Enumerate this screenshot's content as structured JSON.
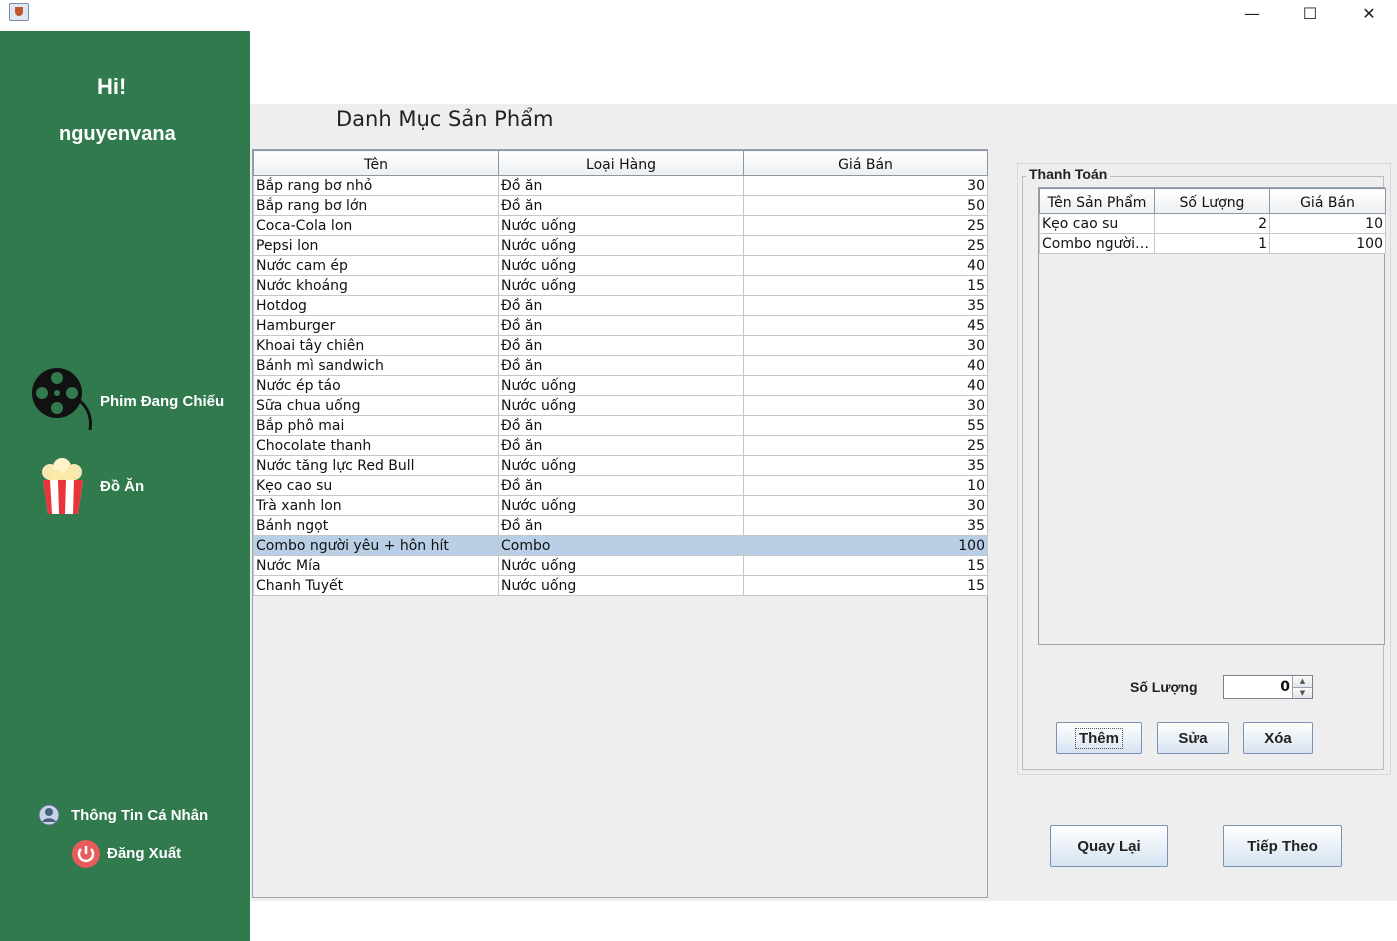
{
  "window": {
    "minimize_glyph": "—",
    "maximize_glyph": "☐",
    "close_glyph": "✕"
  },
  "sidebar": {
    "greeting": "Hi!",
    "username": "nguyenvana",
    "nav": [
      {
        "label": "Phim Đang Chiếu",
        "icon": "film-reel-icon"
      },
      {
        "label": "Đồ Ăn",
        "icon": "popcorn-icon"
      }
    ],
    "profile_label": "Thông Tin Cá Nhân",
    "logout_label": "Đăng Xuất"
  },
  "main": {
    "heading": "Danh Mục Sản Phẩm",
    "columns": [
      "Tên",
      "Loại Hàng",
      "Giá Bán"
    ],
    "rows": [
      [
        "Bắp rang bơ nhỏ",
        "Đồ ăn",
        "30"
      ],
      [
        "Bắp rang bơ lớn",
        "Đồ ăn",
        "50"
      ],
      [
        "Coca-Cola lon",
        "Nước uống",
        "25"
      ],
      [
        "Pepsi lon",
        "Nước uống",
        "25"
      ],
      [
        "Nước cam ép",
        "Nước uống",
        "40"
      ],
      [
        "Nước khoáng",
        "Nước uống",
        "15"
      ],
      [
        "Hotdog",
        "Đồ ăn",
        "35"
      ],
      [
        "Hamburger",
        "Đồ ăn",
        "45"
      ],
      [
        "Khoai tây chiên",
        "Đồ ăn",
        "30"
      ],
      [
        "Bánh mì sandwich",
        "Đồ ăn",
        "40"
      ],
      [
        "Nước ép táo",
        "Nước uống",
        "40"
      ],
      [
        "Sữa chua uống",
        "Nước uống",
        "30"
      ],
      [
        "Bắp phô mai",
        "Đồ ăn",
        "55"
      ],
      [
        "Chocolate thanh",
        "Đồ ăn",
        "25"
      ],
      [
        "Nước tăng lực Red Bull",
        "Nước uống",
        "35"
      ],
      [
        "Kẹo cao su",
        "Đồ ăn",
        "10"
      ],
      [
        "Trà xanh lon",
        "Nước uống",
        "30"
      ],
      [
        "Bánh ngọt",
        "Đồ ăn",
        "35"
      ],
      [
        "Combo người yêu + hôn hít",
        "Combo",
        "100"
      ],
      [
        "Nước Mía",
        "Nước uống",
        "15"
      ],
      [
        "Chanh Tuyết",
        "Nước uống",
        "15"
      ]
    ],
    "selected_row": 18
  },
  "payment": {
    "title": "Thanh Toán",
    "columns": [
      "Tên Sản Phẩm",
      "Số Lượng",
      "Giá Bán"
    ],
    "rows": [
      [
        "Kẹo cao su",
        "2",
        "10"
      ],
      [
        "Combo người y...",
        "1",
        "100"
      ]
    ],
    "qty_label": "Số Lượng",
    "qty_value": "0",
    "add_label": "Thêm",
    "edit_label": "Sửa",
    "delete_label": "Xóa"
  },
  "footer": {
    "back_label": "Quay Lại",
    "next_label": "Tiếp Theo"
  },
  "colors": {
    "sidebar": "#317a4e",
    "selection": "#b8cfe5"
  }
}
